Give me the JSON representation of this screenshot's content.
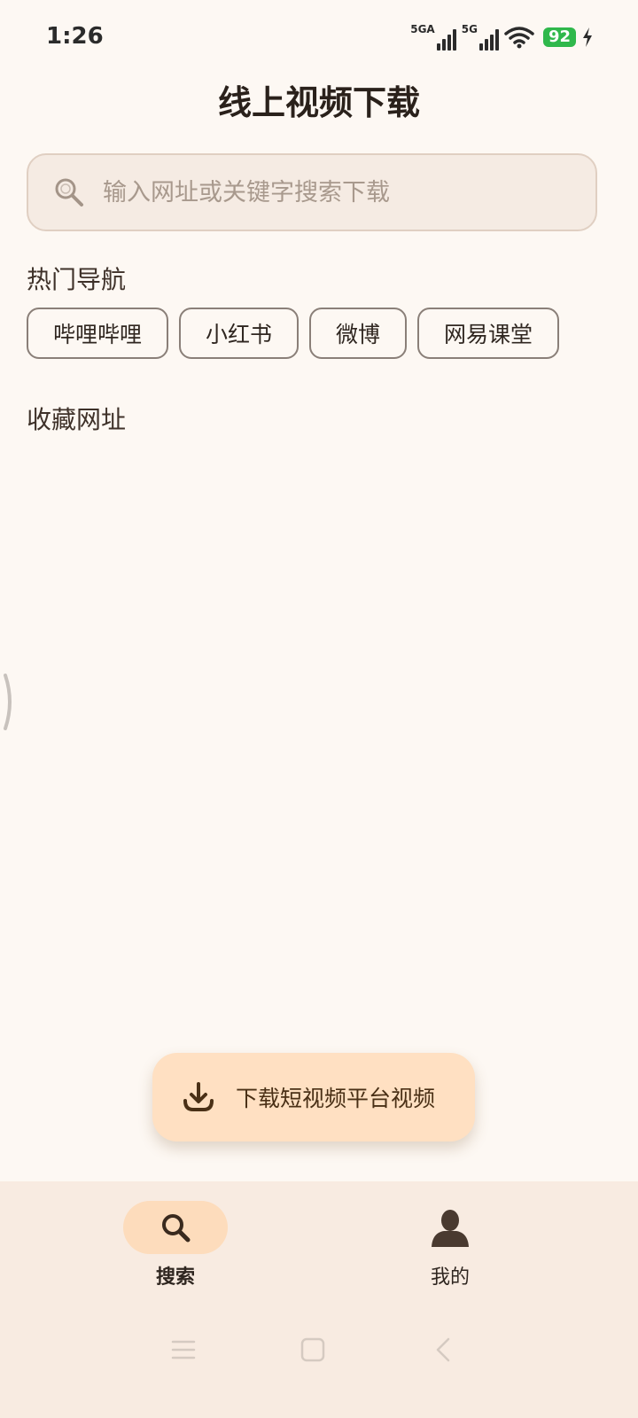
{
  "status_bar": {
    "time": "1:26",
    "signal1_label": "5GA",
    "signal2_label": "5G",
    "wifi_icon": "wifi-icon",
    "battery_level": "92",
    "charging_icon": "bolt-icon",
    "battery_color": "#2fb84b"
  },
  "header": {
    "title": "线上视频下载"
  },
  "search": {
    "placeholder": "输入网址或关键字搜索下载",
    "value": "",
    "icon": "search-icon"
  },
  "hot_nav": {
    "title": "热门导航",
    "items": [
      {
        "label": "哔哩哔哩"
      },
      {
        "label": "小红书"
      },
      {
        "label": "微博"
      },
      {
        "label": "网易课堂"
      }
    ]
  },
  "favorites": {
    "title": "收藏网址"
  },
  "fab": {
    "icon": "download-icon",
    "label": "下载短视频平台视频",
    "color": "#ffe0c2"
  },
  "bottom_nav": {
    "items": [
      {
        "label": "搜索",
        "icon": "search-icon",
        "active": true
      },
      {
        "label": "我的",
        "icon": "person-icon",
        "active": false
      }
    ]
  },
  "system_nav": {
    "buttons": [
      "menu-icon",
      "home-icon",
      "back-icon"
    ]
  },
  "colors": {
    "background": "#fdf8f3",
    "accent": "#fddcbc",
    "nav_background": "#f8ebe1"
  }
}
